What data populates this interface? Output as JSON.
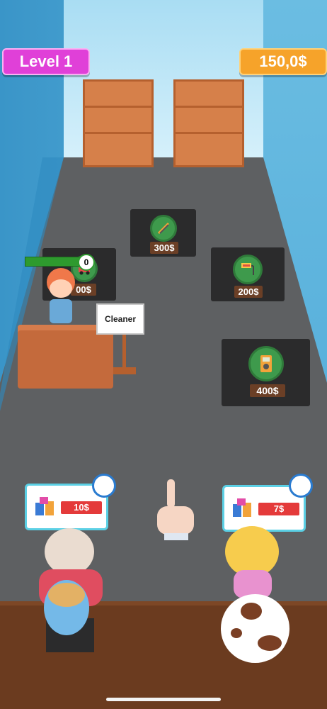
{
  "hud": {
    "level_label": "Level 1",
    "money_label": "150,0$",
    "level_color": "#e040d8",
    "money_color": "#f6a32a"
  },
  "stations": [
    {
      "icon": "tweezers-icon",
      "price": "300$"
    },
    {
      "icon": "toy-car-icon",
      "price": "00$"
    },
    {
      "icon": "paint-roller-icon",
      "price": "200$"
    },
    {
      "icon": "multimeter-icon",
      "price": "400$"
    }
  ],
  "worker": {
    "role_sign": "Cleaner",
    "progress_count": "0"
  },
  "customers": [
    {
      "item": "cleaning-supplies-icon",
      "price": "10$"
    },
    {
      "item": "cleaning-supplies-icon",
      "price": "7$"
    }
  ],
  "tutorial": {
    "icon": "pointing-hand-icon"
  }
}
